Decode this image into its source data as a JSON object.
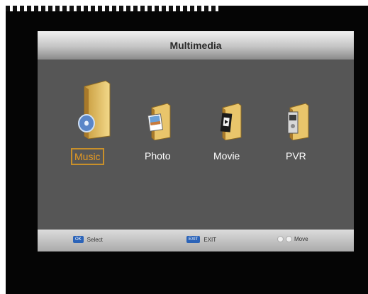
{
  "title": "Multimedia",
  "items": [
    {
      "label": "Music"
    },
    {
      "label": "Photo"
    },
    {
      "label": "Movie"
    },
    {
      "label": "PVR"
    }
  ],
  "selected_item": "Music",
  "footer": {
    "hints": [
      {
        "key": "OK",
        "label": "Select"
      },
      {
        "key": "EXIT",
        "label": "EXIT"
      },
      {
        "key": "",
        "label": "Move"
      }
    ]
  },
  "colors": {
    "panel": "#565656",
    "selection": "#e59a22",
    "key_button": "#2b63b8"
  },
  "icons": [
    "music-folder-icon",
    "photo-folder-icon",
    "movie-folder-icon",
    "pvr-folder-icon"
  ]
}
